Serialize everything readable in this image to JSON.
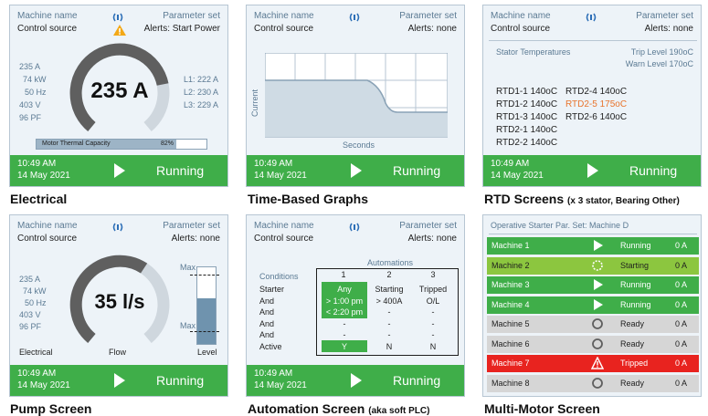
{
  "common": {
    "machine_name_label": "Machine name",
    "parameter_set_label": "Parameter set",
    "control_source": "Control source",
    "time": "10:49 AM",
    "date": "14 May 2021",
    "status": "Running",
    "alerts_none": "Alerts: none"
  },
  "electrical": {
    "alerts": "Alerts: Start Power",
    "value": "235 A",
    "left_readings": [
      "235 A",
      "74  kW",
      "50 Hz",
      "403 V",
      "96 PF"
    ],
    "right_readings": [
      "L1: 222 A",
      "L2: 230 A",
      "L3: 229 A"
    ],
    "thermal_label": "Motor Thermal Capacity",
    "thermal_value": "82%",
    "thermal_fraction": 0.82,
    "gauge_fraction": 0.78,
    "caption": "Electrical"
  },
  "graphs": {
    "y_label": "Current",
    "x_label": "Seconds",
    "caption": "Time-Based Graphs"
  },
  "rtd": {
    "title": "Stator Temperatures",
    "trip": "Trip Level 190oC",
    "warn": "Warn Level 170oC",
    "col1": [
      "RTD1-1 140oC",
      "RTD1-2 140oC",
      "RTD1-3 140oC",
      "RTD2-1 140oC",
      "RTD2-2 140oC"
    ],
    "col2": [
      "RTD2-4 140oC",
      "RTD2-5 175oC",
      "RTD2-6 140oC"
    ],
    "caption": "RTD Screens",
    "caption_note": "(x 3 stator, Bearing Other)"
  },
  "pump": {
    "value": "35 l/s",
    "left_readings": [
      "235 A",
      "74  kW",
      "50 Hz",
      "403 V",
      "96 PF"
    ],
    "max_top": "Max",
    "max_bottom": "Max",
    "label_electrical": "Electrical",
    "label_flow": "Flow",
    "label_level": "Level",
    "gauge_fraction": 0.62,
    "level_fraction": 0.6,
    "caption": "Pump Screen"
  },
  "automation": {
    "title": "Automations",
    "conditions_label": "Conditions",
    "row_labels": [
      "Starter",
      "And",
      "And",
      "And",
      "And",
      "Active"
    ],
    "col_headers": [
      "1",
      "2",
      "3"
    ],
    "col1": [
      "Any",
      "> 1:00 pm",
      "< 2:20 pm",
      "-",
      "-",
      "Y"
    ],
    "col2": [
      "Starting",
      "> 400A",
      "-",
      "-",
      "-",
      "N"
    ],
    "col3": [
      "Tripped",
      "O/L",
      "-",
      "-",
      "-",
      "N"
    ],
    "caption": "Automation Screen",
    "caption_note": "(aka soft PLC)"
  },
  "multi": {
    "header": "Operative Starter Par. Set: Machine D",
    "rows": [
      {
        "name": "Machine 1",
        "status": "Running",
        "amps": "0 A",
        "icon": "play-icon"
      },
      {
        "name": "Machine 2",
        "status": "Starting",
        "amps": "0 A",
        "icon": "starting-icon"
      },
      {
        "name": "Machine 3",
        "status": "Running",
        "amps": "0 A",
        "icon": "play-icon"
      },
      {
        "name": "Machine 4",
        "status": "Running",
        "amps": "0 A",
        "icon": "play-icon"
      },
      {
        "name": "Machine 5",
        "status": "Ready",
        "amps": "0 A",
        "icon": "ready-icon"
      },
      {
        "name": "Machine 6",
        "status": "Ready",
        "amps": "0 A",
        "icon": "ready-icon"
      },
      {
        "name": "Machine 7",
        "status": "Tripped",
        "amps": "0 A",
        "icon": "warning-icon"
      },
      {
        "name": "Machine 8",
        "status": "Ready",
        "amps": "0 A",
        "icon": "ready-icon"
      }
    ],
    "caption": "Multi-Motor Screen"
  },
  "colors": {
    "green": "#3fae49",
    "light_green": "#8cc63f",
    "red": "#e8231f",
    "gray": "#d6d6d6",
    "accent_orange": "#e8742c",
    "gauge_gray": "#5f5f5f"
  }
}
